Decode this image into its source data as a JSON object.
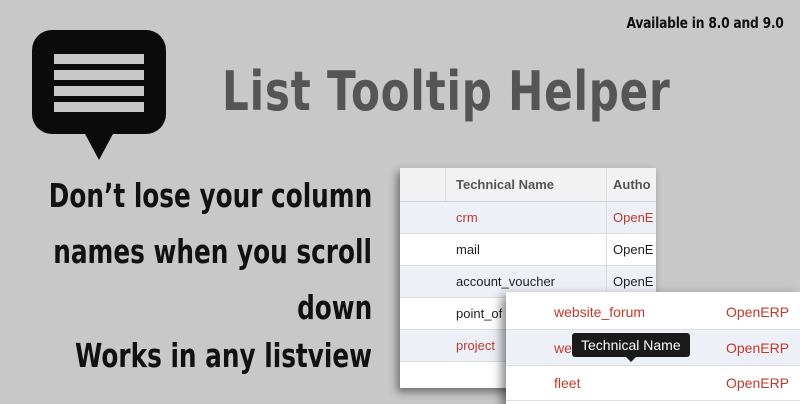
{
  "banner": {
    "availability": "Available in 8.0 and 9.0",
    "title": "List Tooltip Helper",
    "tagline": [
      "Don’t lose your column",
      "names when you scroll",
      "down",
      "Works in any listview"
    ],
    "logo_icon": "speech-bubble-list-icon"
  },
  "table1": {
    "headers": [
      "",
      "Technical Name",
      "Autho"
    ],
    "rows": [
      {
        "name": "crm",
        "author": "OpenE",
        "style": "red"
      },
      {
        "name": "mail",
        "author": "OpenE",
        "style": "dark"
      },
      {
        "name": "account_voucher",
        "author": "OpenE",
        "style": "dark"
      },
      {
        "name": "point_of",
        "author": "",
        "style": "dark"
      },
      {
        "name": "project",
        "author": "",
        "style": "red"
      }
    ]
  },
  "table2": {
    "rows": [
      {
        "name": "website_forum",
        "author": "OpenERP"
      },
      {
        "name": "we",
        "author": "OpenERP"
      },
      {
        "name": "fleet",
        "author": "OpenERP"
      }
    ]
  },
  "tooltip": {
    "text": "Technical Name"
  },
  "colors": {
    "background": "#c8c8c8",
    "accent_red": "#c0392b",
    "title_gray": "#555555"
  }
}
